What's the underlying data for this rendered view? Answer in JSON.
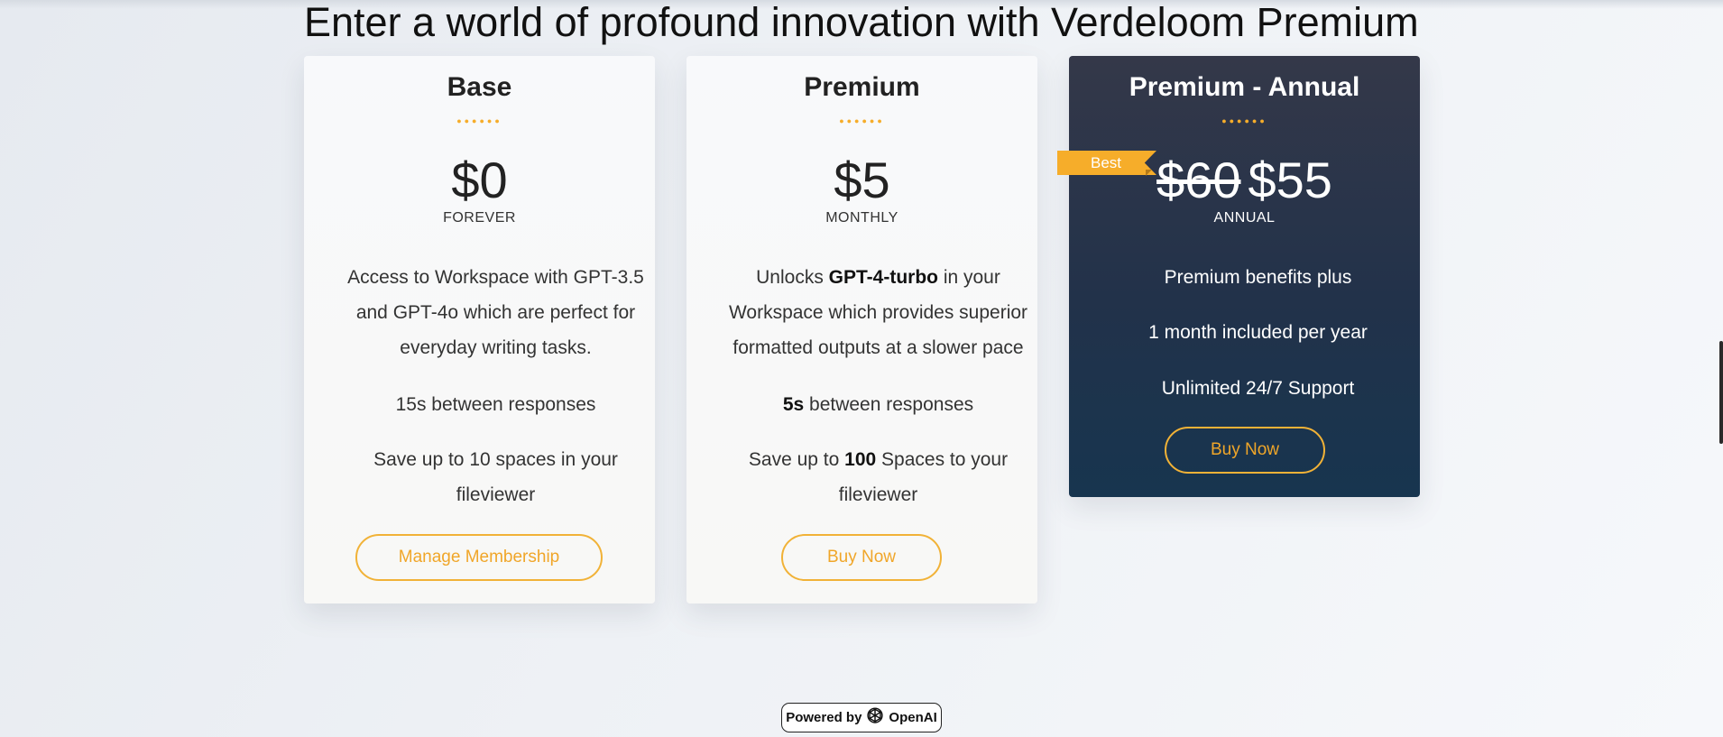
{
  "headline": "Enter a world of profound innovation with Verdeloom Premium",
  "accent_color": "#f6ad2a",
  "plans": {
    "base": {
      "title": "Base",
      "dots": "●●●●●●",
      "price": "$0",
      "period": "FOREVER",
      "features": [
        "Access to Workspace with GPT-3.5 and GPT-4o which are perfect for everyday writing tasks.",
        "15s between responses",
        "Save up to 10 spaces in your fileviewer"
      ],
      "button_label": "Manage Membership"
    },
    "premium": {
      "title": "Premium",
      "dots": "●●●●●●",
      "price": "$5",
      "period": "MONTHLY",
      "features": {
        "f1_pre": "Unlocks ",
        "f1_bold": "GPT-4-turbo",
        "f1_post": " in your Workspace which provides superior formatted outputs at a slower pace",
        "f2_bold": "5s",
        "f2_post": " between responses",
        "f3_pre": "Save up to ",
        "f3_bold": "100",
        "f3_post": " Spaces to your fileviewer"
      },
      "button_label": "Buy Now"
    },
    "annual": {
      "title": "Premium - Annual",
      "dots": "●●●●●●",
      "old_price": "$60",
      "price": "$55",
      "period": "ANNUAL",
      "ribbon": "Best",
      "features": [
        "Premium benefits plus",
        "1 month included per year",
        "Unlimited 24/7 Support"
      ],
      "button_label": "Buy Now"
    }
  },
  "footer": {
    "powered_by": "Powered by",
    "brand": "OpenAI",
    "icon": "openai-logo-icon"
  }
}
